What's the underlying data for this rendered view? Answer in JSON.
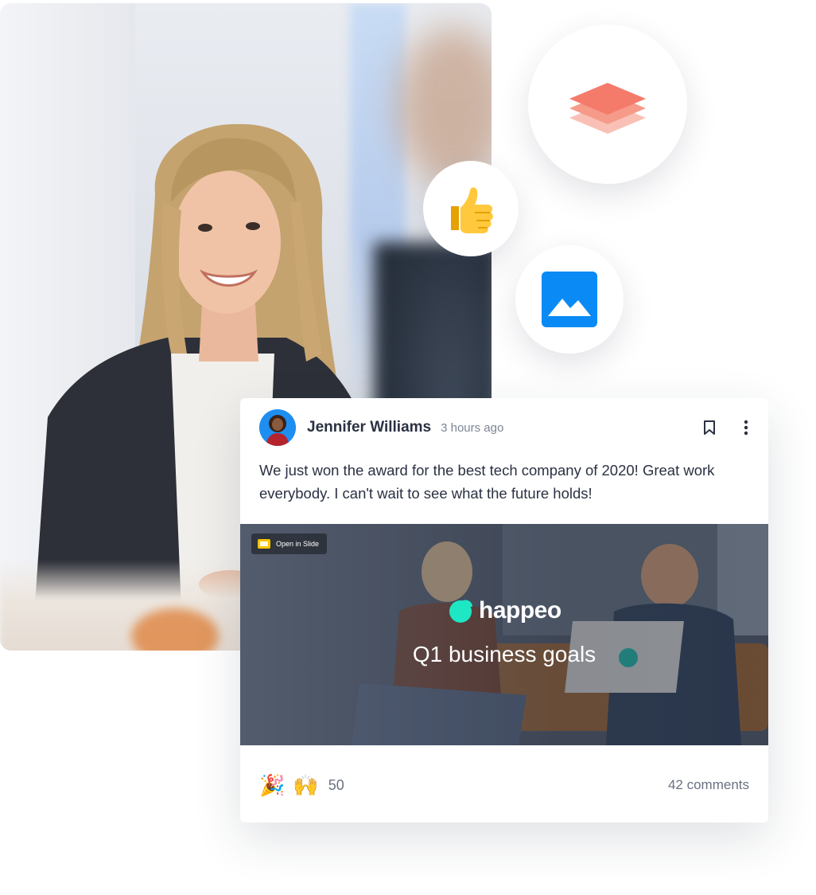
{
  "post": {
    "author": "Jennifer Williams",
    "time": "3 hours ago",
    "text": "We just won the award for the best tech company of 2020! Great work everybody. I can't wait to see what the future holds!",
    "slide": {
      "open_label": "Open in Slide",
      "brand": "happeo",
      "title": "Q1 business goals"
    },
    "reactions": {
      "emojis": [
        "🎉",
        "🙌"
      ],
      "count": "50"
    },
    "comments": "42 comments"
  },
  "icons": {
    "layers": "layers-icon",
    "thumbs_up": "thumbs-up-icon",
    "image": "image-icon",
    "bookmark": "bookmark-icon",
    "more": "more-vertical-icon"
  },
  "colors": {
    "layers_accent": "#f47b6a",
    "image_accent": "#0a8af4",
    "slide_badge": "#f7c500",
    "brand_mark": "#1ee8c4",
    "avatar_bg": "#1e8ef0"
  }
}
